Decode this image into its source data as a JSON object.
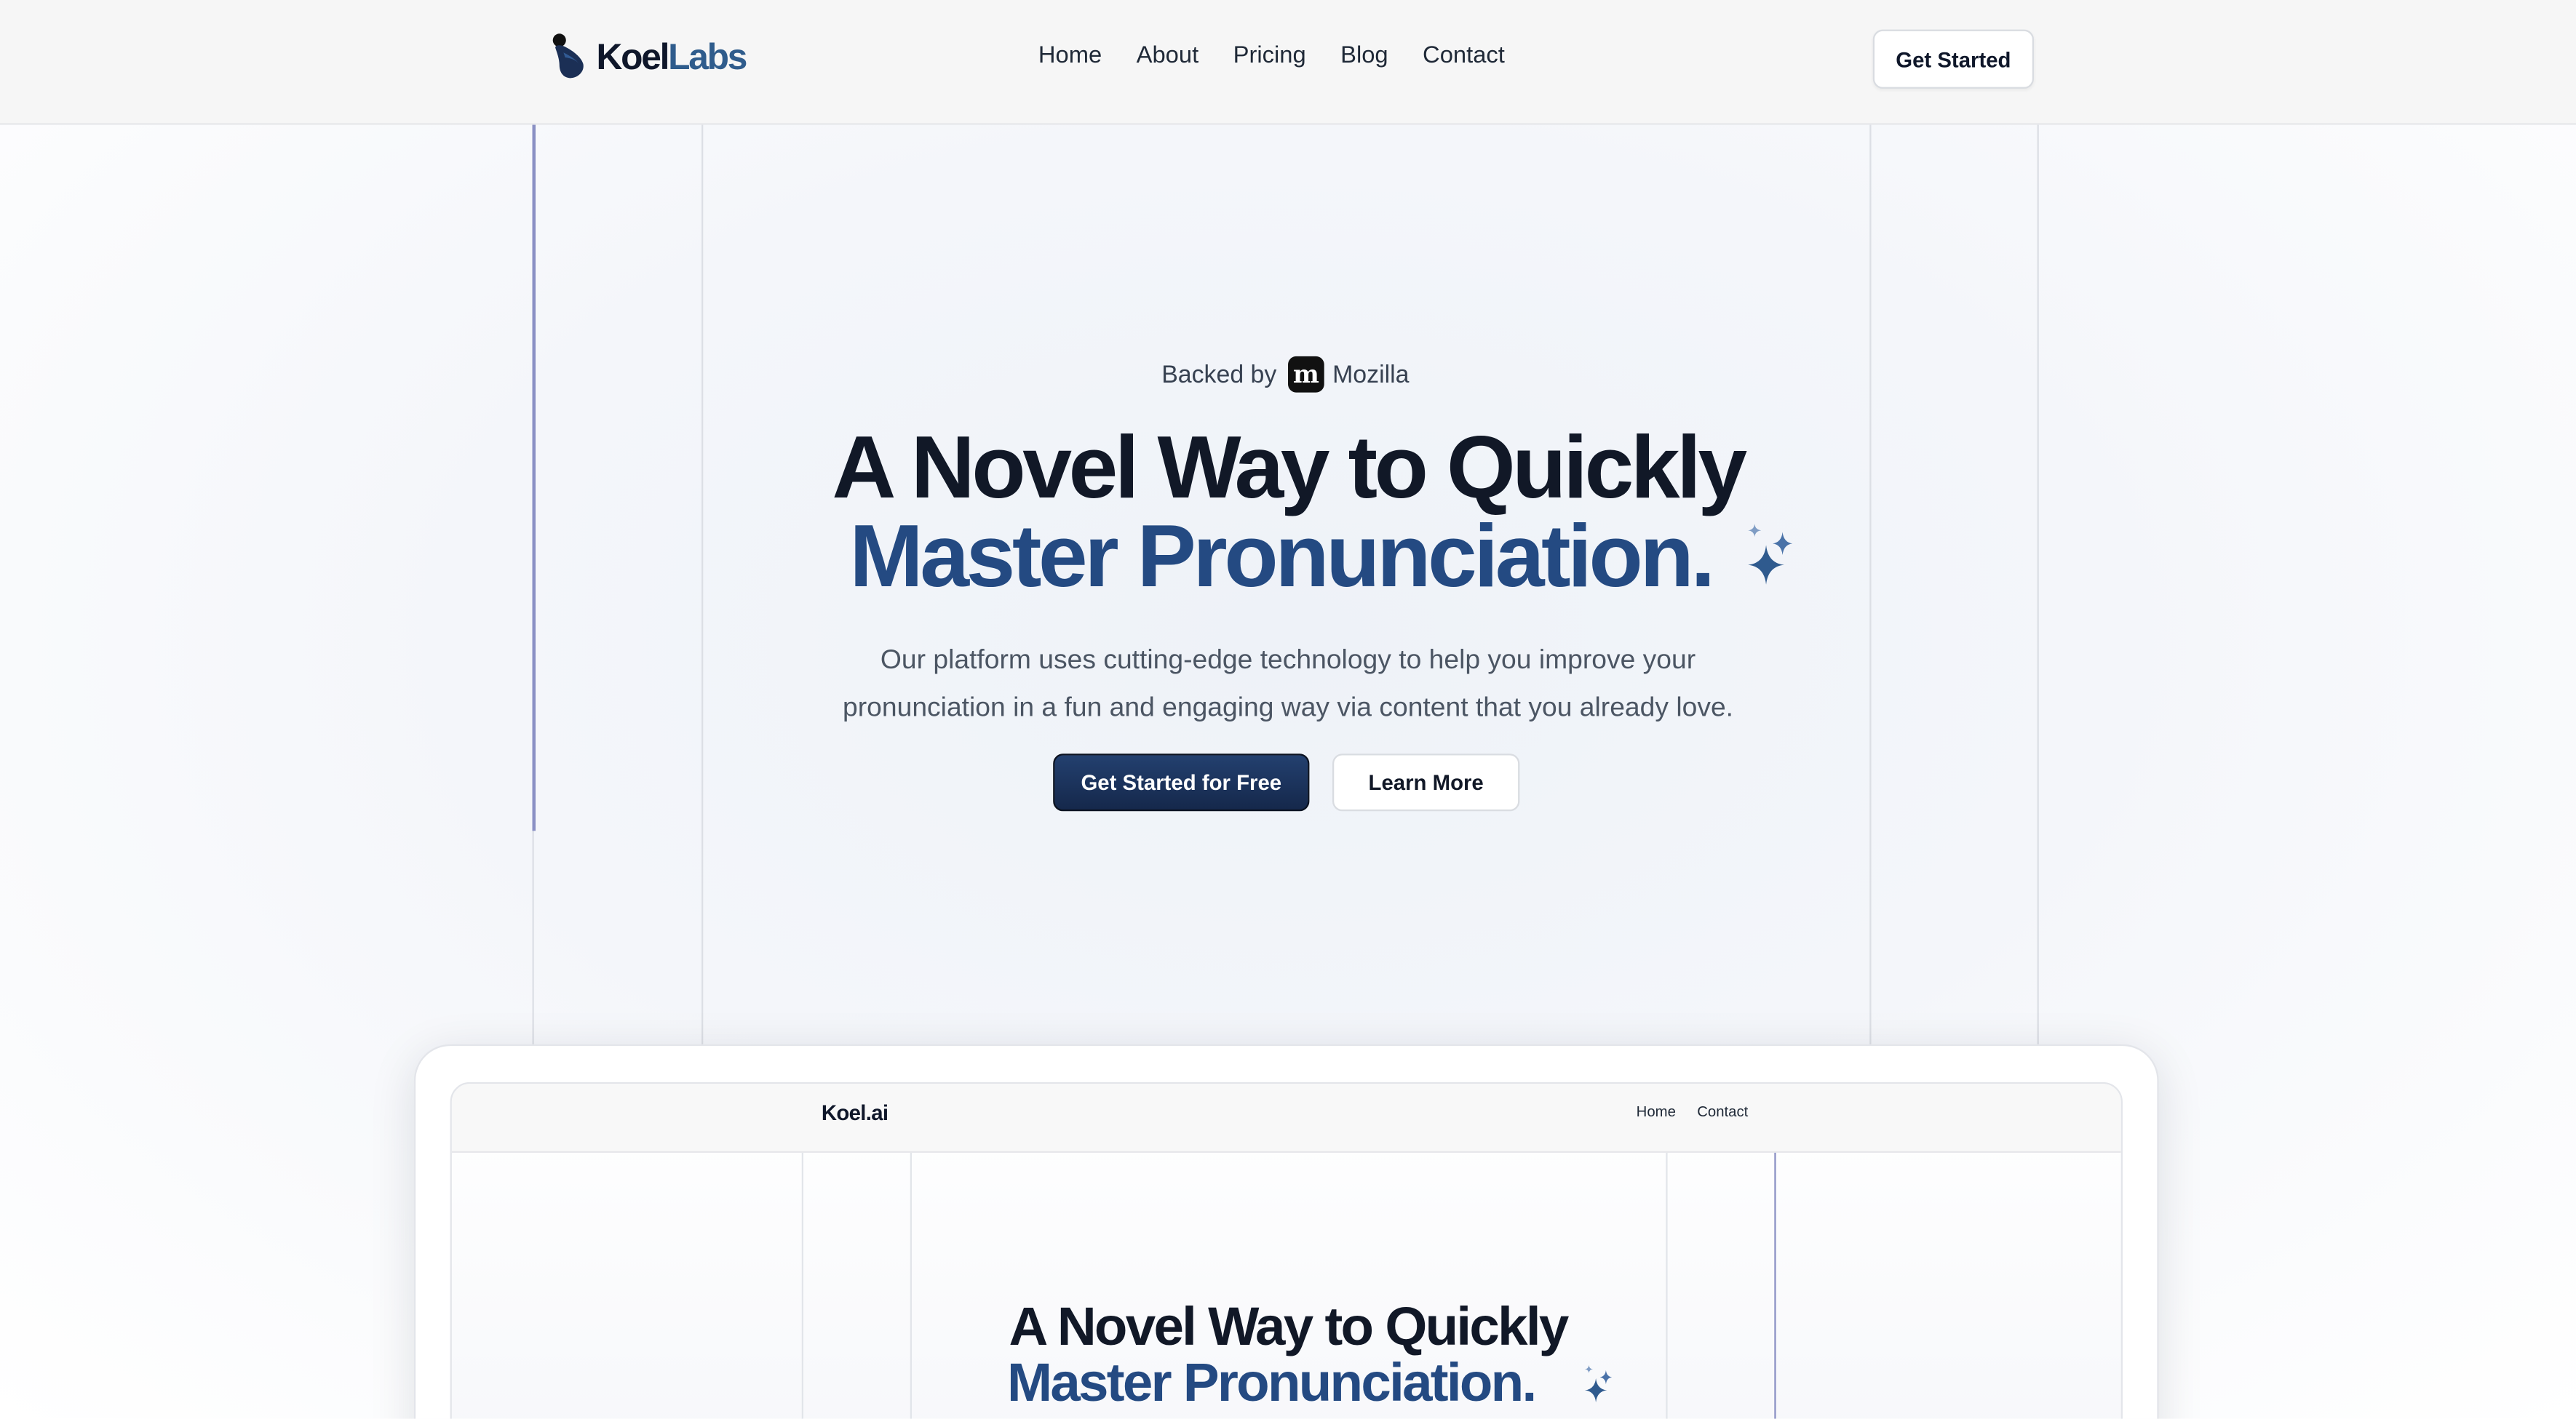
{
  "header": {
    "brand_primary": "Koel",
    "brand_accent": "Labs",
    "logo_icon": "koel-bird-logo",
    "nav_links": [
      "Home",
      "About",
      "Pricing",
      "Blog",
      "Contact"
    ],
    "cta_label": "Get Started"
  },
  "hero": {
    "badge_prefix": "Backed by",
    "badge_logo_letter": "m",
    "badge_name": "Mozilla",
    "title_line1": "A Novel Way to Quickly",
    "title_line2": "Master Pronunciation.",
    "sparkle_icon": "sparkles-icon",
    "description_line1": "Our platform uses cutting-edge technology to help you improve your",
    "description_line2": "pronunciation in a fun and engaging way via content that you already love.",
    "primary_cta": "Get Started for Free",
    "secondary_cta": "Learn More"
  },
  "preview": {
    "brand": "Koel.ai",
    "nav_links": [
      "Home",
      "Contact"
    ],
    "title_line1": "A Novel Way to Quickly",
    "title_line2": "Master Pronunciation."
  },
  "colors": {
    "accent_blue": "#244a82",
    "primary_button": "#1b325c",
    "text_dark": "#111827"
  }
}
